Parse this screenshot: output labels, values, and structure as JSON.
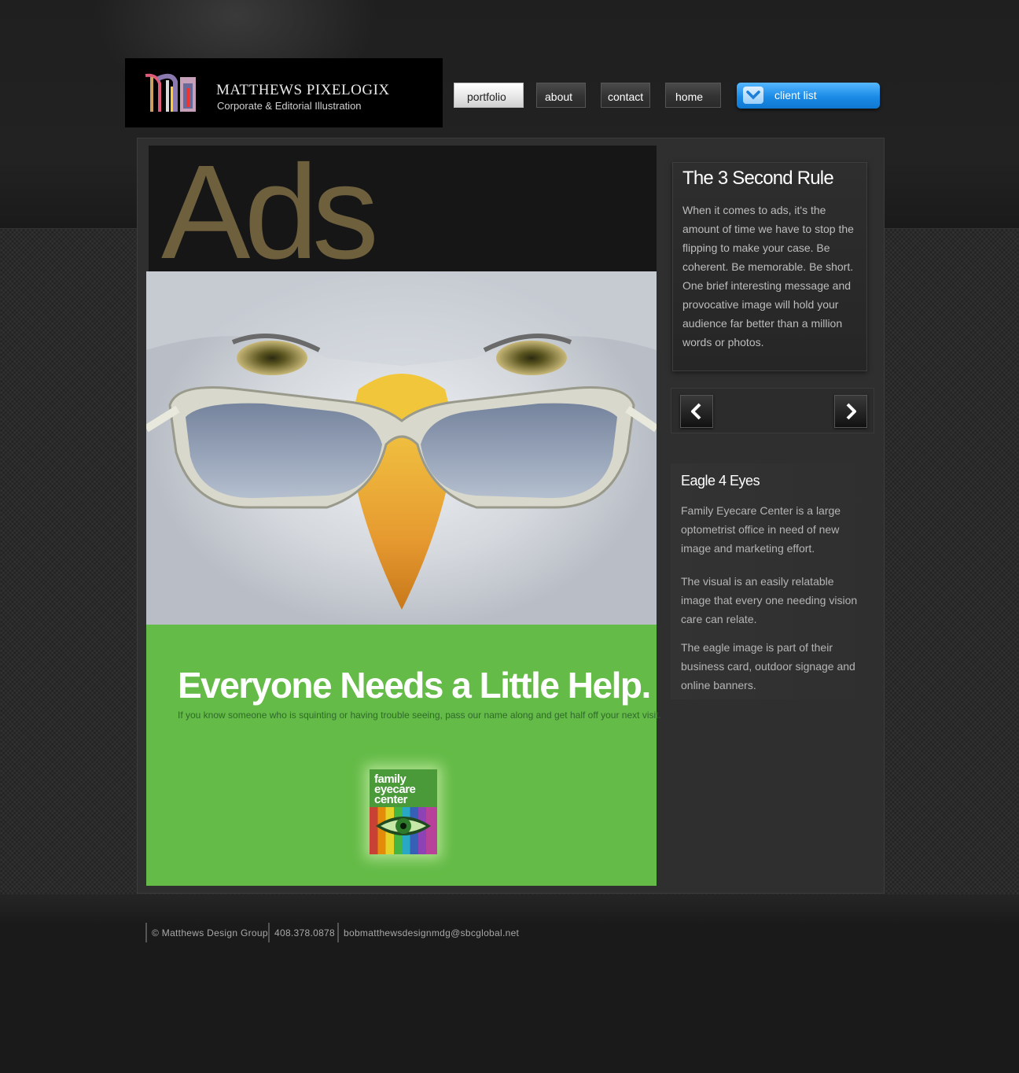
{
  "brand": {
    "title": "MATTHEWS PIXELOGIX",
    "subtitle": "Corporate & Editorial Illustration"
  },
  "nav": {
    "portfolio": "portfolio",
    "about": "about",
    "contact": "contact",
    "home": "home",
    "client_list": "client list"
  },
  "hero": {
    "section_title": "Ads"
  },
  "ad": {
    "headline": "Everyone Needs a Little Help.",
    "tagline": "If you know someone who is squinting or having trouble seeing, pass our name along and get half off your next visit.",
    "logo_lines": [
      "family",
      "eyecare",
      "center"
    ]
  },
  "sidebar": {
    "rule_title": "The 3 Second Rule",
    "rule_text": "When it comes to ads, it's the amount of time we have to stop the flipping to make your case. Be coherent. Be memorable. Be short. One brief interesting message and provocative image will hold your audience far better than a million words or photos.",
    "project_title": "Eagle 4 Eyes",
    "project_p1": "Family Eyecare Center is a large optometrist office in need of new image and marketing effort.",
    "project_p2": "The visual is an easily relatable image that every one needing vision care can relate.",
    "project_p3": "The eagle image is part of their business card, outdoor signage and online banners."
  },
  "footer": {
    "copyright": "© Matthews Design Group",
    "phone": "408.378.0878",
    "email": "bobmatthewsdesignmdg@sbcglobal.net"
  },
  "colors": {
    "accent_blue": "#1a8be6",
    "ad_green": "#64bb47",
    "ads_title_gold": "#6e5f3d"
  }
}
